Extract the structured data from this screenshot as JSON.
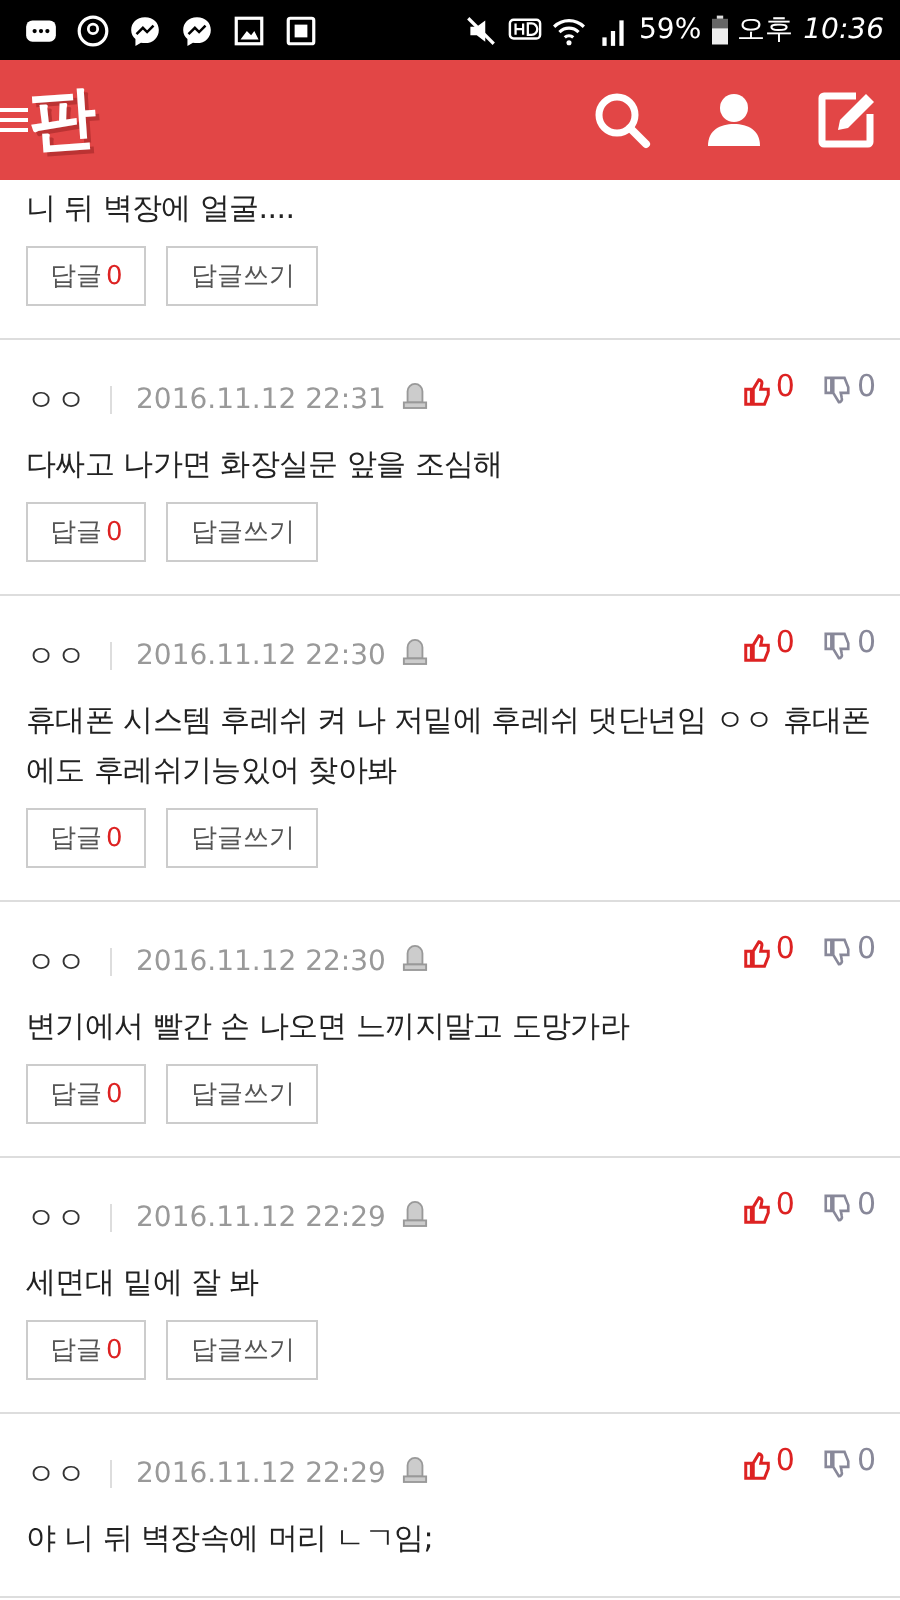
{
  "status_bar": {
    "battery": "59%",
    "ampm": "오후",
    "time": "10:36"
  },
  "header": {
    "logo": "판"
  },
  "top_comment": {
    "text": "니 뒤 벽장에 얼굴....",
    "reply_label": "답글",
    "reply_count": "0",
    "write_label": "답글쓰기"
  },
  "comments": [
    {
      "author": "ㅇㅇ",
      "date": "2016.11.12 22:31",
      "likes": "0",
      "dislikes": "0",
      "text": "다싸고 나가면 화장실문 앞을 조심해",
      "reply_label": "답글",
      "reply_count": "0",
      "write_label": "답글쓰기"
    },
    {
      "author": "ㅇㅇ",
      "date": "2016.11.12 22:30",
      "likes": "0",
      "dislikes": "0",
      "text": "휴대폰 시스템 후레쉬 켜 나 저밑에 후레쉬 댓단년임 ㅇㅇ 휴대폰에도 후레쉬기능있어 찾아봐",
      "reply_label": "답글",
      "reply_count": "0",
      "write_label": "답글쓰기"
    },
    {
      "author": "ㅇㅇ",
      "date": "2016.11.12 22:30",
      "likes": "0",
      "dislikes": "0",
      "text": "변기에서 빨간 손 나오면 느끼지말고 도망가라",
      "reply_label": "답글",
      "reply_count": "0",
      "write_label": "답글쓰기"
    },
    {
      "author": "ㅇㅇ",
      "date": "2016.11.12 22:29",
      "likes": "0",
      "dislikes": "0",
      "text": "세면대 밑에 잘 봐",
      "reply_label": "답글",
      "reply_count": "0",
      "write_label": "답글쓰기"
    },
    {
      "author": "ㅇㅇ",
      "date": "2016.11.12 22:29",
      "likes": "0",
      "dislikes": "0",
      "text": "야 니 뒤 벽장속에 머리 ㄴㄱ임;"
    }
  ]
}
